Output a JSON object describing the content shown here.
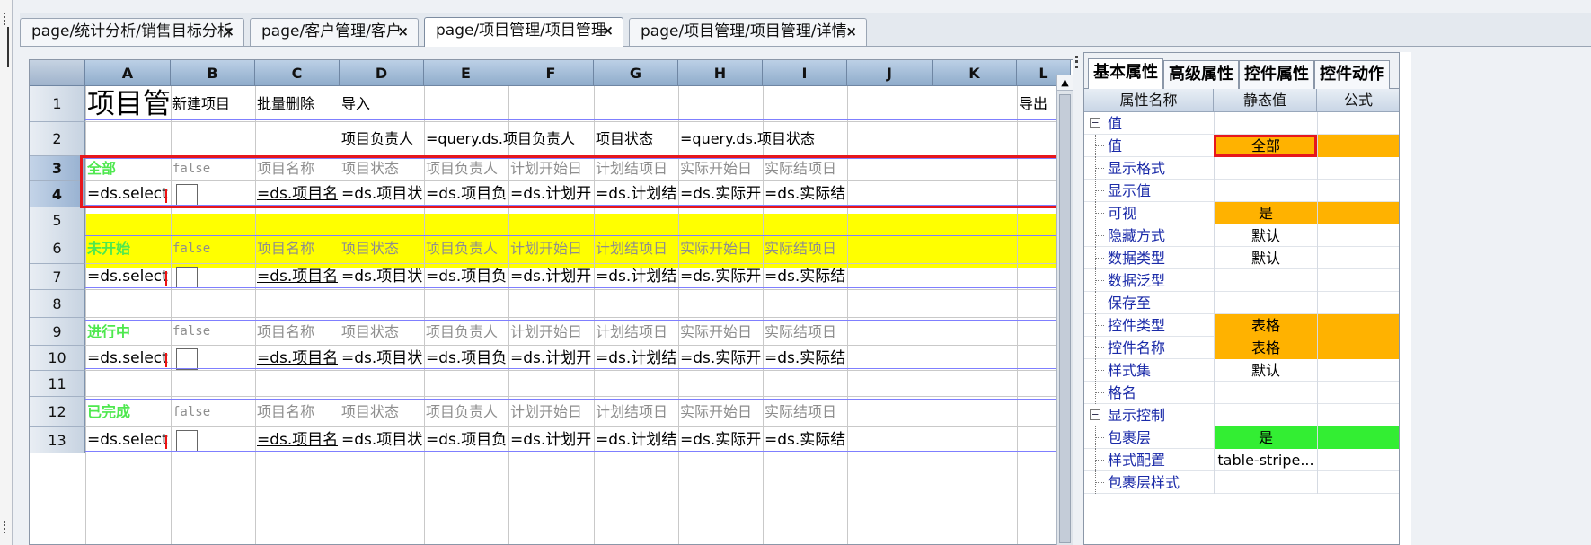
{
  "tabs": [
    {
      "label": "page/统计分析/销售目标分析",
      "close": "×",
      "active": false
    },
    {
      "label": "page/客户管理/客户",
      "close": "×",
      "active": false
    },
    {
      "label": "page/项目管理/项目管理",
      "close": "×",
      "active": true
    },
    {
      "label": "page/项目管理/项目管理/详情",
      "close": "×",
      "active": false
    }
  ],
  "sheet": {
    "columns": [
      "A",
      "B",
      "C",
      "D",
      "E",
      "F",
      "G",
      "H",
      "I",
      "J",
      "K",
      "L"
    ],
    "rows": [
      "1",
      "2",
      "3",
      "4",
      "5",
      "6",
      "7",
      "8",
      "9",
      "10",
      "11",
      "12",
      "13"
    ],
    "selected_rows": [
      "3",
      "4"
    ],
    "row1": {
      "title": "项目管",
      "new": "新建项目",
      "batch_delete": "批量删除",
      "import": "导入",
      "export": "导出"
    },
    "row2": {
      "owner_label": "项目负责人",
      "owner_formula": "=query.ds.项目负责人",
      "status_label": "项目状态",
      "status_formula": "=query.ds.项目状态"
    },
    "groups": [
      {
        "label": "全部",
        "bool": "false",
        "headers": [
          "项目名称",
          "项目状态",
          "项目负责人",
          "计划开始日",
          "计划结项日",
          "实际开始日",
          "实际结项日"
        ],
        "select": "=ds.select(",
        "formulas": [
          "=ds.项目名",
          "=ds.项目状",
          "=ds.项目负",
          "=ds.计划开",
          "=ds.计划结",
          "=ds.实际开",
          "=ds.实际结"
        ]
      },
      {
        "label": "未开始",
        "bool": "false",
        "headers": [
          "项目名称",
          "项目状态",
          "项目负责人",
          "计划开始日",
          "计划结项日",
          "实际开始日",
          "实际结项日"
        ],
        "select": "=ds.select(",
        "formulas": [
          "=ds.项目名",
          "=ds.项目状",
          "=ds.项目负",
          "=ds.计划开",
          "=ds.计划结",
          "=ds.实际开",
          "=ds.实际结"
        ]
      },
      {
        "label": "进行中",
        "bool": "false",
        "headers": [
          "项目名称",
          "项目状态",
          "项目负责人",
          "计划开始日",
          "计划结项日",
          "实际开始日",
          "实际结项日"
        ],
        "select": "=ds.select(",
        "formulas": [
          "=ds.项目名",
          "=ds.项目状",
          "=ds.项目负",
          "=ds.计划开",
          "=ds.计划结",
          "=ds.实际开",
          "=ds.实际结"
        ]
      },
      {
        "label": "已完成",
        "bool": "false",
        "headers": [
          "项目名称",
          "项目状态",
          "项目负责人",
          "计划开始日",
          "计划结项日",
          "实际开始日",
          "实际结项日"
        ],
        "select": "=ds.select(",
        "formulas": [
          "=ds.项目名",
          "=ds.项目状",
          "=ds.项目负",
          "=ds.计划开",
          "=ds.计划结",
          "=ds.实际开",
          "=ds.实际结"
        ]
      }
    ]
  },
  "panel": {
    "tabs": [
      "基本属性",
      "高级属性",
      "控件属性",
      "控件动作"
    ],
    "headers": {
      "name": "属性名称",
      "static": "静态值",
      "formula": "公式"
    },
    "rows": [
      {
        "type": "group",
        "name": "值",
        "value": "",
        "bg": ""
      },
      {
        "type": "item",
        "name": "值",
        "value": "全部",
        "bg": "orange",
        "redbox": true
      },
      {
        "type": "item",
        "name": "显示格式",
        "value": "",
        "bg": ""
      },
      {
        "type": "item",
        "name": "显示值",
        "value": "",
        "bg": ""
      },
      {
        "type": "item",
        "name": "可视",
        "value": "是",
        "bg": "orange"
      },
      {
        "type": "item",
        "name": "隐藏方式",
        "value": "默认",
        "bg": ""
      },
      {
        "type": "item",
        "name": "数据类型",
        "value": "默认",
        "bg": ""
      },
      {
        "type": "item",
        "name": "数据泛型",
        "value": "",
        "bg": ""
      },
      {
        "type": "item",
        "name": "保存至",
        "value": "",
        "bg": ""
      },
      {
        "type": "item",
        "name": "控件类型",
        "value": "表格",
        "bg": "orange"
      },
      {
        "type": "item",
        "name": "控件名称",
        "value": "表格",
        "bg": "orange"
      },
      {
        "type": "item",
        "name": "样式集",
        "value": "默认",
        "bg": ""
      },
      {
        "type": "item",
        "name": "格名",
        "value": "",
        "bg": ""
      },
      {
        "type": "group",
        "name": "显示控制",
        "value": "",
        "bg": ""
      },
      {
        "type": "item",
        "name": "包裹层",
        "value": "是",
        "bg": "green"
      },
      {
        "type": "item",
        "name": "样式配置",
        "value": "table-stripe...",
        "bg": ""
      },
      {
        "type": "item",
        "name": "包裹层样式",
        "value": "",
        "bg": ""
      }
    ],
    "colors": {
      "orange": "#ffb200",
      "green": "#33ee33",
      "highlight": "#ffff00",
      "selection": "#e6171c"
    }
  }
}
